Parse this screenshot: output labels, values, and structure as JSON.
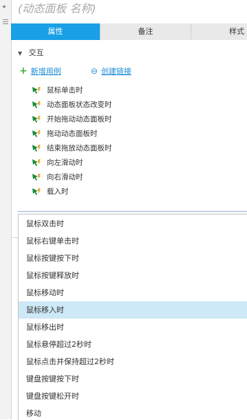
{
  "panel": {
    "title": "(动态面板 名称)"
  },
  "tabs": [
    {
      "label": "属性",
      "active": true
    },
    {
      "label": "备注",
      "active": false
    },
    {
      "label": "样式",
      "active": false
    }
  ],
  "interaction": {
    "section_label": "交互",
    "add_case_label": "新增用例",
    "create_link_label": "创建链接"
  },
  "events": [
    "鼠标单击时",
    "动态面板状态改变时",
    "开始拖动动态面板时",
    "拖动动态面板时",
    "结束拖放动态面板时",
    "向左滑动时",
    "向右滑动时",
    "载入时"
  ],
  "dropdown": {
    "selected": "鼠标移入时",
    "options": [
      "鼠标双击时",
      "鼠标右键单击时",
      "鼠标按键按下时",
      "鼠标按键释放时",
      "鼠标移动时",
      "鼠标移入时",
      "鼠标移出时",
      "鼠标悬停超过2秒时",
      "鼠标点击并保持超过2秒时",
      "键盘按键按下时",
      "键盘按键松开时",
      "移动"
    ]
  },
  "colors": {
    "tab_active": "#1aa0e6",
    "link": "#1a8cd8",
    "event_icon": "#1a8a3a",
    "selected_row": "#cde8f6"
  },
  "icons": {
    "event": "cursor-lightning-icon",
    "add": "plus-icon",
    "link": "chain-link-icon",
    "collapse": "chevron-down-icon"
  }
}
